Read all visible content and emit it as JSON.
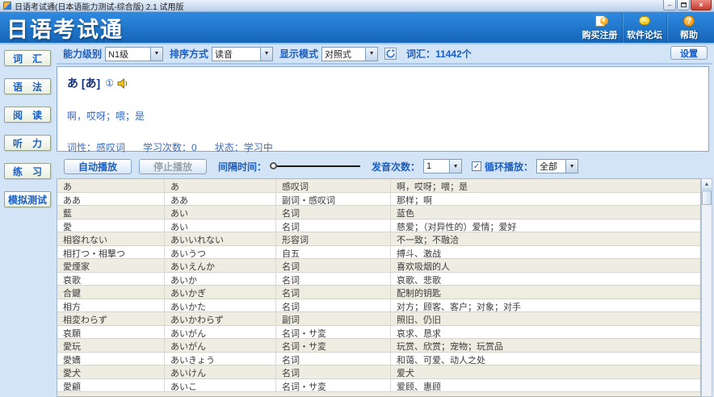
{
  "window": {
    "title": "日语考试通(日本语能力测试-综合版) 2.1 试用版",
    "minimize_glyph": "–",
    "close_glyph": "×"
  },
  "header": {
    "logo": "日语考试通",
    "actions": [
      {
        "label": "购买注册",
        "icon": "register-icon"
      },
      {
        "label": "软件论坛",
        "icon": "forum-icon"
      },
      {
        "label": "帮助",
        "icon": "help-icon"
      }
    ]
  },
  "sidebar": {
    "items": [
      {
        "label": "词　汇"
      },
      {
        "label": "语　法"
      },
      {
        "label": "阅　读"
      },
      {
        "label": "听　力"
      },
      {
        "label": "练　习"
      },
      {
        "label": "模拟测试"
      }
    ]
  },
  "toolbar": {
    "level_label": "能力级别",
    "level_value": "N1级",
    "sort_label": "排序方式",
    "sort_value": "读音",
    "display_label": "显示模式",
    "display_value": "对照式",
    "count_label": "词汇：",
    "count_value": "11442个",
    "settings_label": "设置"
  },
  "detail": {
    "word": "あ [あ]",
    "accent": "①",
    "meaning": "啊，哎呀；喂；是",
    "pos_label": "词性：",
    "pos_value": "感叹词",
    "study_label": "学习次数：",
    "study_value": "0",
    "status_label": "状态：",
    "status_value": "学习中"
  },
  "playback": {
    "auto_play_label": "自动播放",
    "stop_play_label": "停止播放",
    "interval_label": "间隔时间：",
    "times_label": "发音次数：",
    "times_value": "1",
    "loop_checked_glyph": "✓",
    "loop_label": "循环播放：",
    "loop_value": "全部"
  },
  "table": {
    "rows": [
      [
        "あ",
        "あ",
        "感叹词",
        "啊，哎呀；喂；是"
      ],
      [
        "ああ",
        "ああ",
        "副词・感叹词",
        "那样；啊"
      ],
      [
        "藍",
        "あい",
        "名词",
        "蓝色"
      ],
      [
        "愛",
        "あい",
        "名词",
        "慈爱；（对异性的）爱情；爱好"
      ],
      [
        "相容れない",
        "あいいれない",
        "形容词",
        "不一致；不融洽"
      ],
      [
        "相打つ・相撃つ",
        "あいうつ",
        "自五",
        "搏斗、激战"
      ],
      [
        "愛煙家",
        "あいえんか",
        "名词",
        "喜欢吸烟的人"
      ],
      [
        "哀歌",
        "あいか",
        "名词",
        "哀歌、悲歌"
      ],
      [
        "合鍵",
        "あいかぎ",
        "名词",
        "配制的钥匙"
      ],
      [
        "相方",
        "あいかた",
        "名词",
        "对方；顾客、客户；对象；对手"
      ],
      [
        "相変わらず",
        "あいかわらず",
        "副词",
        "照旧、仍旧"
      ],
      [
        "哀願",
        "あいがん",
        "名词・サ変",
        "哀求、恳求"
      ],
      [
        "愛玩",
        "あいがん",
        "名词・サ変",
        "玩赏、欣赏；宠物；玩赏品"
      ],
      [
        "愛嬌",
        "あいきょう",
        "名词",
        "和蔼、可爱、动人之处"
      ],
      [
        "愛犬",
        "あいけん",
        "名词",
        "爱犬"
      ],
      [
        "愛顧",
        "あいこ",
        "名词・サ変",
        "爱顾、惠顾"
      ]
    ]
  },
  "colors": {
    "header_blue": "#1d74cc",
    "link_blue": "#1b5ec4",
    "row_alt": "#efede2",
    "page_bg": "#d2e4f6"
  }
}
